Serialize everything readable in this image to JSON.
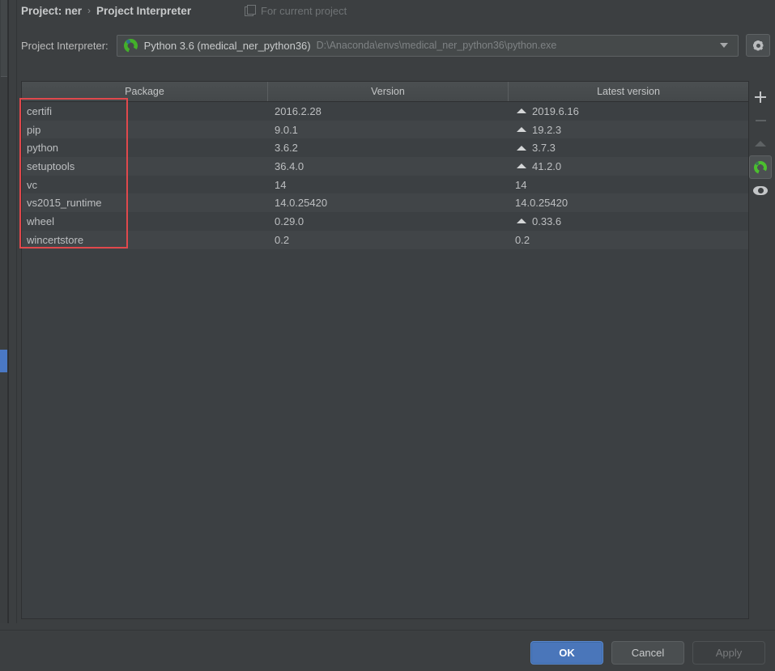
{
  "window": {
    "breadcrumb": {
      "project_label": "Project: ner",
      "separator": "›",
      "page_label": "Project Interpreter"
    },
    "scope_note": {
      "icon": "copy-icon",
      "label": "For current project"
    }
  },
  "interpreter": {
    "label": "Project Interpreter:",
    "icon": "conda-env-icon",
    "name": "Python 3.6 (medical_ner_python36)",
    "path": "D:\\Anaconda\\envs\\medical_ner_python36\\python.exe",
    "dropdown_icon": "chevron-down-icon",
    "settings_icon": "gear-icon"
  },
  "packages_table": {
    "columns": [
      "Package",
      "Version",
      "Latest version"
    ],
    "rows": [
      {
        "package": "certifi",
        "version": "2016.2.28",
        "latest": "2019.6.16",
        "upgradable": true
      },
      {
        "package": "pip",
        "version": "9.0.1",
        "latest": "19.2.3",
        "upgradable": true
      },
      {
        "package": "python",
        "version": "3.6.2",
        "latest": "3.7.3",
        "upgradable": true
      },
      {
        "package": "setuptools",
        "version": "36.4.0",
        "latest": "41.2.0",
        "upgradable": true
      },
      {
        "package": "vc",
        "version": "14",
        "latest": "14",
        "upgradable": false
      },
      {
        "package": "vs2015_runtime",
        "version": "14.0.25420",
        "latest": "14.0.25420",
        "upgradable": false
      },
      {
        "package": "wheel",
        "version": "0.29.0",
        "latest": "0.33.6",
        "upgradable": true
      },
      {
        "package": "wincertstore",
        "version": "0.2",
        "latest": "0.2",
        "upgradable": false
      }
    ]
  },
  "toolbar": {
    "buttons": [
      {
        "name": "install-package-button",
        "icon": "plus-icon",
        "enabled": true
      },
      {
        "name": "uninstall-package-button",
        "icon": "minus-icon",
        "enabled": false
      },
      {
        "name": "upgrade-package-button",
        "icon": "up-arrow-icon",
        "enabled": false
      },
      {
        "name": "conda-manager-button",
        "icon": "conda-icon",
        "enabled": true
      },
      {
        "name": "show-early-releases-button",
        "icon": "eye-icon",
        "enabled": true
      }
    ]
  },
  "footer": {
    "ok_label": "OK",
    "cancel_label": "Cancel",
    "apply_label": "Apply"
  },
  "annotation": {
    "type": "red-rectangle-highlight",
    "target": "package-name-column"
  },
  "colors": {
    "background": "#3c3f41",
    "panel": "#3c4043",
    "row_alt": "#414548",
    "accent_blue": "#4a76ba",
    "annotation_red": "#e0484c",
    "conda_green": "#43b02a",
    "text": "#bbbbbb",
    "text_dim": "#7e8284"
  }
}
